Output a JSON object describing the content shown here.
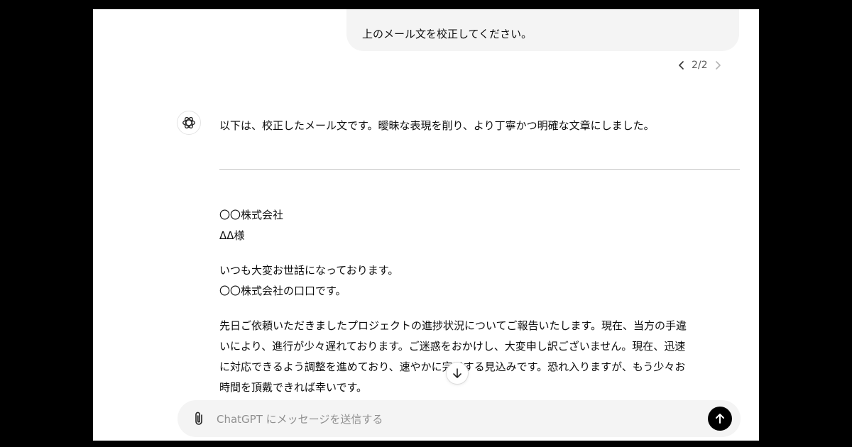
{
  "conversation": {
    "user_message": "上のメール文を校正してください。",
    "pager": {
      "current": "2/2"
    }
  },
  "assistant": {
    "intro": "以下は、校正したメール文です。曖昧な表現を削り、より丁寧かつ明確な文章にしました。",
    "letter": {
      "company": "〇〇株式会社",
      "recipient": "ΔΔ様",
      "greeting_1": "いつも大変お世話になっております。",
      "greeting_2": "〇〇株式会社の口口です。",
      "body_lines": [
        "先日ご依頼いただきましたプロジェクトの進捗状況についてご報告いたします。現在、当方の手違",
        "いにより、進行が少々遅れております。ご迷惑をおかけし、大変申し訳ございません。現在、迅速",
        "に対応できるよう調整を進めており、速やかに完了する見込みです。恐れ入りますが、もう少々お",
        "時間を頂戴できれば幸いです。"
      ]
    }
  },
  "composer": {
    "placeholder": "ChatGPT にメッセージを送信する"
  },
  "icons": {
    "pager_prev": "chevron-left-icon",
    "pager_next": "chevron-right-icon",
    "avatar": "openai-logo-icon",
    "scroll": "arrow-down-icon",
    "attach": "paperclip-icon",
    "send": "arrow-up-icon"
  },
  "colors": {
    "bubble": "#f4f4f4",
    "send_button": "#000000",
    "frame": "#000000"
  }
}
